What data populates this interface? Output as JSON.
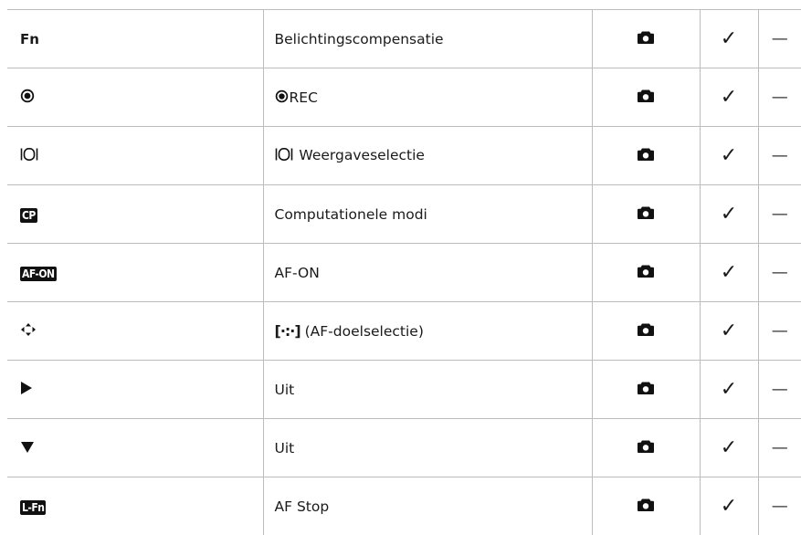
{
  "rows": [
    {
      "button": {
        "type": "text",
        "text": "Fn"
      },
      "function": {
        "prefix_icon": null,
        "text": "Belichtingscompensatie"
      },
      "mode_icon": "camera-icon",
      "check": "✓",
      "dash": "—"
    },
    {
      "button": {
        "type": "icon",
        "icon": "record-icon"
      },
      "function": {
        "prefix_icon": "record-icon",
        "text": "REC"
      },
      "mode_icon": "camera-icon",
      "check": "✓",
      "dash": "—"
    },
    {
      "button": {
        "type": "icon",
        "icon": "display-selection-icon"
      },
      "function": {
        "prefix_icon": "display-selection-icon",
        "text": " Weergaveselectie"
      },
      "mode_icon": "camera-icon",
      "check": "✓",
      "dash": "—"
    },
    {
      "button": {
        "type": "badge",
        "text": "CP"
      },
      "function": {
        "prefix_icon": null,
        "text": "Computationele modi"
      },
      "mode_icon": "camera-icon",
      "check": "✓",
      "dash": "—"
    },
    {
      "button": {
        "type": "badge",
        "text": "AF-ON"
      },
      "function": {
        "prefix_icon": null,
        "text": "AF-ON"
      },
      "mode_icon": "camera-icon",
      "check": "✓",
      "dash": "—"
    },
    {
      "button": {
        "type": "icon",
        "icon": "multi-selector-icon"
      },
      "function": {
        "prefix_icon": "af-target-icon",
        "text": " (AF-doelselectie)"
      },
      "mode_icon": "camera-icon",
      "check": "✓",
      "dash": "—"
    },
    {
      "button": {
        "type": "icon",
        "icon": "arrow-right-icon"
      },
      "function": {
        "prefix_icon": null,
        "text": "Uit"
      },
      "mode_icon": "camera-icon",
      "check": "✓",
      "dash": "—"
    },
    {
      "button": {
        "type": "icon",
        "icon": "arrow-down-icon"
      },
      "function": {
        "prefix_icon": null,
        "text": "Uit"
      },
      "mode_icon": "camera-icon",
      "check": "✓",
      "dash": "—"
    },
    {
      "button": {
        "type": "badge",
        "text": "L-Fn"
      },
      "function": {
        "prefix_icon": null,
        "text": "AF Stop"
      },
      "mode_icon": "camera-icon",
      "check": "✓",
      "dash": "—"
    }
  ],
  "glyphs": {
    "af_target": "[·:·]"
  }
}
